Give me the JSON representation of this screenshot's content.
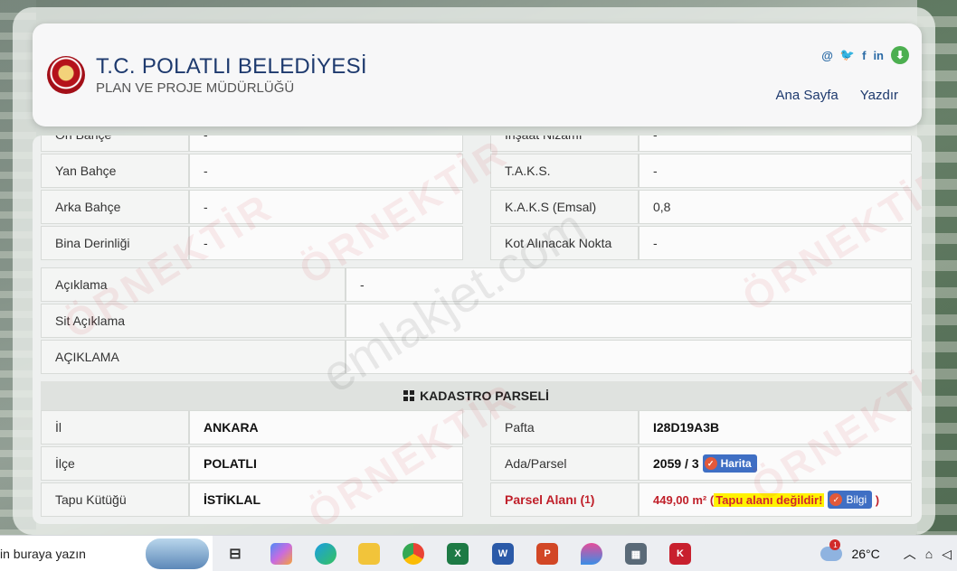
{
  "header": {
    "title": "T.C. POLATLI BELEDİYESİ",
    "subtitle": "PLAN VE PROJE MÜDÜRLÜĞÜ",
    "social": [
      "@",
      "twitter",
      "f",
      "in",
      "download"
    ],
    "nav": [
      "Ana Sayfa",
      "Yazdır"
    ]
  },
  "top_rows": [
    {
      "l_label": "Ön Bahçe",
      "l_value": "-",
      "r_label": "İnşaat Nizamı",
      "r_value": "-"
    },
    {
      "l_label": "Yan Bahçe",
      "l_value": "-",
      "r_label": "T.A.K.S.",
      "r_value": "-"
    },
    {
      "l_label": "Arka Bahçe",
      "l_value": "-",
      "r_label": "K.A.K.S (Emsal)",
      "r_value": "0,8"
    },
    {
      "l_label": "Bina Derinliği",
      "l_value": "-",
      "r_label": "Kot Alınacak Nokta",
      "r_value": "-"
    }
  ],
  "notes": [
    {
      "label": "Açıklama",
      "value": "-"
    },
    {
      "label": "Sit Açıklama",
      "value": ""
    },
    {
      "label": "AÇIKLAMA",
      "value": ""
    }
  ],
  "section": {
    "title": "KADASTRO PARSELİ"
  },
  "kadastro": {
    "il_label": "İl",
    "il_value": "ANKARA",
    "ilce_label": "İlçe",
    "ilce_value": "POLATLI",
    "tapu_label": "Tapu Kütüğü",
    "tapu_value": "İSTİKLAL",
    "pafta_label": "Pafta",
    "pafta_value": "I28D19A3B",
    "ada_label": "Ada/Parsel",
    "ada_value": "2059 / 3",
    "harita_btn": "Harita",
    "alan_label": "Parsel Alanı",
    "alan_sup": "1",
    "alan_value": "449,00 m²",
    "alan_warning": "Tapu alanı değildir!",
    "bilgi_btn": "Bilgi"
  },
  "watermarks": [
    "ÖRNEKTİR",
    "emlakjet.com"
  ],
  "taskbar": {
    "search_text": "in buraya yazın",
    "temperature": "26°C",
    "weather_badge": "1"
  }
}
